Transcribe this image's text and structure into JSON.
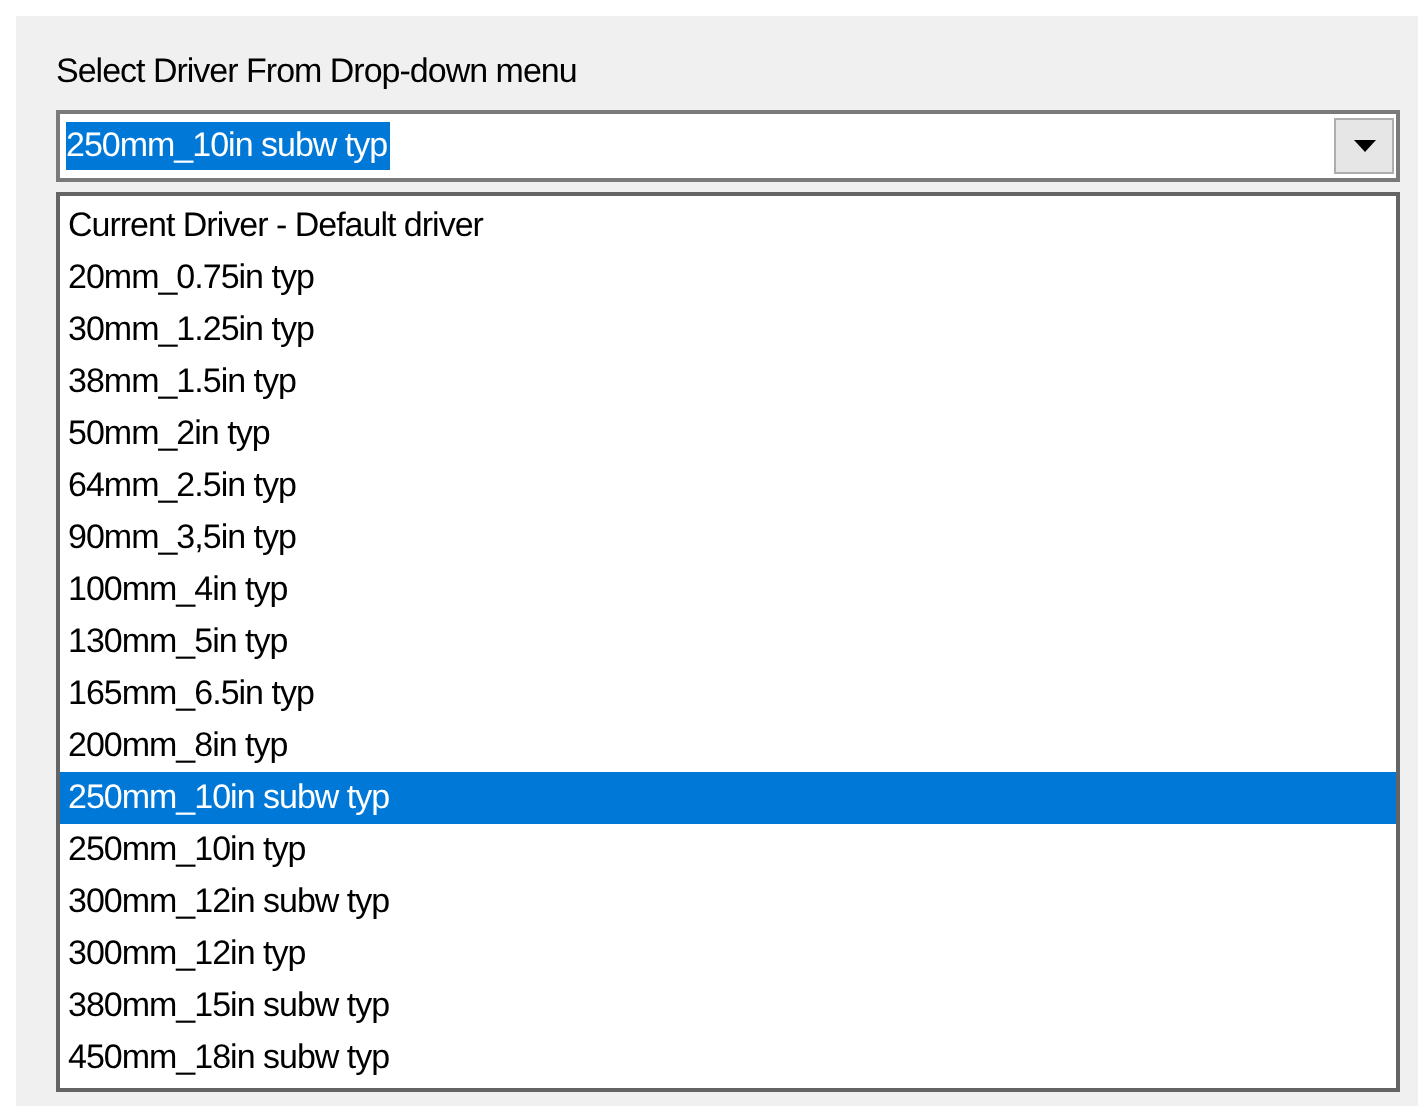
{
  "label": "Select Driver From Drop-down menu",
  "combo": {
    "value": "250mm_10in subw typ"
  },
  "options": [
    {
      "label": "Current Driver - Default driver",
      "selected": false
    },
    {
      "label": "20mm_0.75in typ",
      "selected": false
    },
    {
      "label": "30mm_1.25in typ",
      "selected": false
    },
    {
      "label": "38mm_1.5in typ",
      "selected": false
    },
    {
      "label": "50mm_2in typ",
      "selected": false
    },
    {
      "label": "64mm_2.5in typ",
      "selected": false
    },
    {
      "label": "90mm_3,5in typ",
      "selected": false
    },
    {
      "label": "100mm_4in typ",
      "selected": false
    },
    {
      "label": "130mm_5in typ",
      "selected": false
    },
    {
      "label": "165mm_6.5in typ",
      "selected": false
    },
    {
      "label": "200mm_8in typ",
      "selected": false
    },
    {
      "label": "250mm_10in subw typ",
      "selected": true
    },
    {
      "label": "250mm_10in typ",
      "selected": false
    },
    {
      "label": "300mm_12in subw typ",
      "selected": false
    },
    {
      "label": "300mm_12in typ",
      "selected": false
    },
    {
      "label": "380mm_15in subw typ",
      "selected": false
    },
    {
      "label": "450mm_18in subw typ",
      "selected": false
    }
  ]
}
